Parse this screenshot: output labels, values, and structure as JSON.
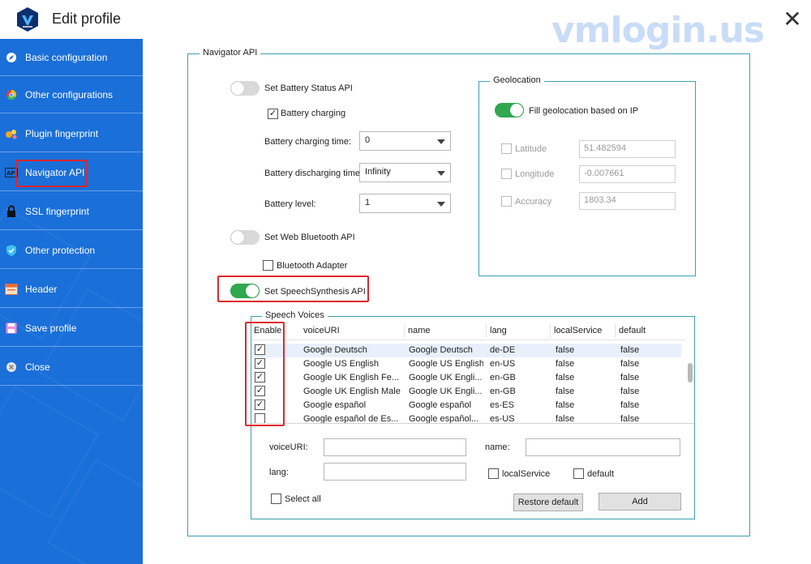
{
  "window": {
    "title": "Edit profile",
    "watermark": "vmlogin.us"
  },
  "sidebar": {
    "items": [
      {
        "label": "Basic configuration",
        "icon": "compass-icon"
      },
      {
        "label": "Other configurations",
        "icon": "chrome-icon"
      },
      {
        "label": "Plugin fingerprint",
        "icon": "plugin-icon"
      },
      {
        "label": "Navigator API",
        "icon": "api-icon",
        "active": true
      },
      {
        "label": "SSL fingerprint",
        "icon": "lock-icon"
      },
      {
        "label": "Other protection",
        "icon": "shield-icon"
      },
      {
        "label": "Header",
        "icon": "header-icon"
      },
      {
        "label": "Save profile",
        "icon": "save-icon"
      },
      {
        "label": "Close",
        "icon": "close-circle-icon"
      }
    ]
  },
  "navigator": {
    "legend": "Navigator API",
    "battery": {
      "toggle_label": "Set Battery Status API",
      "charging_label": "Battery charging",
      "charging_time_label": "Battery charging time:",
      "charging_time_value": "0",
      "discharging_time_label": "Battery discharging time",
      "discharging_time_value": "Infinity",
      "level_label": "Battery level:",
      "level_value": "1"
    },
    "bluetooth": {
      "toggle_label": "Set Web Bluetooth API",
      "adapter_label": "Bluetooth Adapter"
    },
    "speech": {
      "toggle_label": "Set SpeechSynthesis API"
    },
    "geolocation": {
      "legend": "Geolocation",
      "toggle_label": "Fill geolocation based on IP",
      "latitude_label": "Latitude",
      "latitude_value": "51.482594",
      "longitude_label": "Longitude",
      "longitude_value": "-0.007661",
      "accuracy_label": "Accuracy",
      "accuracy_value": "1803.34"
    }
  },
  "voices": {
    "legend": "Speech Voices",
    "columns": [
      "Enable",
      "voiceURI",
      "name",
      "lang",
      "localService",
      "default"
    ],
    "rows": [
      {
        "enabled": true,
        "voiceURI": "Google Deutsch",
        "name": "Google Deutsch",
        "lang": "de-DE",
        "local": "false",
        "default": "false"
      },
      {
        "enabled": true,
        "voiceURI": "Google US English",
        "name": "Google US English",
        "lang": "en-US",
        "local": "false",
        "default": "false"
      },
      {
        "enabled": true,
        "voiceURI": "Google UK English Fe...",
        "name": "Google UK Engli...",
        "lang": "en-GB",
        "local": "false",
        "default": "false"
      },
      {
        "enabled": true,
        "voiceURI": "Google UK English Male",
        "name": "Google UK Engli...",
        "lang": "en-GB",
        "local": "false",
        "default": "false"
      },
      {
        "enabled": true,
        "voiceURI": "Google español",
        "name": "Google español",
        "lang": "es-ES",
        "local": "false",
        "default": "false"
      },
      {
        "enabled": false,
        "voiceURI": "Google español de Es...",
        "name": "Google español...",
        "lang": "es-US",
        "local": "false",
        "default": "false"
      }
    ],
    "form": {
      "voiceuri_label": "voiceURI:",
      "name_label": "name:",
      "lang_label": "lang:",
      "local_label": "localService",
      "default_label": "default",
      "select_all_label": "Select all",
      "restore_label": "Restore default",
      "add_label": "Add"
    }
  },
  "colors": {
    "sidebar": "#1a6fd9",
    "toggle_on": "#2fa84f",
    "highlight": "#e0262c",
    "group_border": "#3f9fb6"
  }
}
